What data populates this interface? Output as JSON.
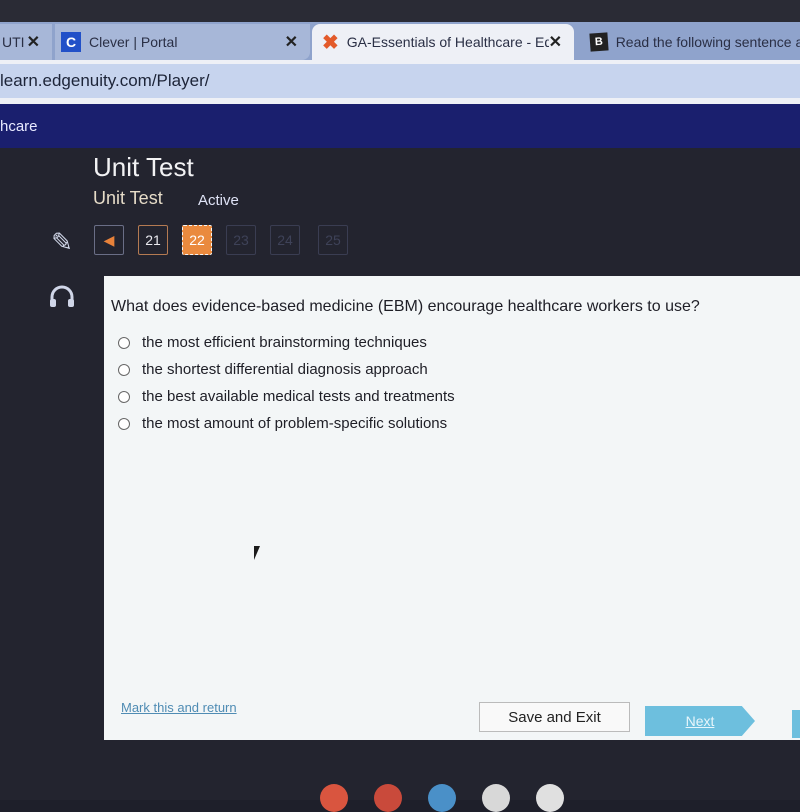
{
  "browser": {
    "tabs": [
      {
        "title": "UTI",
        "icon": "page-icon",
        "active": false
      },
      {
        "title": "Clever | Portal",
        "icon": "clever-logo-icon",
        "active": false
      },
      {
        "title": "GA-Essentials of Healthcare - Ed",
        "icon": "edgenuity-logo-icon",
        "active": true
      },
      {
        "title": "Read the following sentence a",
        "icon": "brainly-logo-icon",
        "active": false
      }
    ],
    "close_glyph": "✕",
    "url": "learn.edgenuity.com/Player/"
  },
  "app": {
    "course_name": "hcare",
    "title": "Unit Test",
    "subtitle": "Unit Test",
    "status": "Active"
  },
  "tools": [
    {
      "name": "pencil-icon",
      "glyph": "✎"
    },
    {
      "name": "headphones-icon",
      "glyph": "🎧"
    }
  ],
  "navigation": {
    "prev_glyph": "◀",
    "questions": [
      {
        "number": "21",
        "state": "answered"
      },
      {
        "number": "22",
        "state": "current"
      },
      {
        "number": "23",
        "state": "locked"
      },
      {
        "number": "24",
        "state": "locked"
      },
      {
        "number": "25",
        "state": "locked"
      }
    ]
  },
  "question": {
    "text": "What does evidence-based medicine (EBM) encourage healthcare workers to use?",
    "options": [
      "the most efficient brainstorming techniques",
      "the shortest differential diagnosis approach",
      "the best available medical tests and treatments",
      "the most amount of problem-specific solutions"
    ]
  },
  "footer": {
    "mark_label": "Mark this and return",
    "save_label": "Save and Exit",
    "next_label": "Next"
  },
  "colors": {
    "accent_orange": "#ea8a3e",
    "header_navy": "#1a1f6e",
    "next_blue": "#6dbfde",
    "link_blue": "#4f8cb4"
  }
}
